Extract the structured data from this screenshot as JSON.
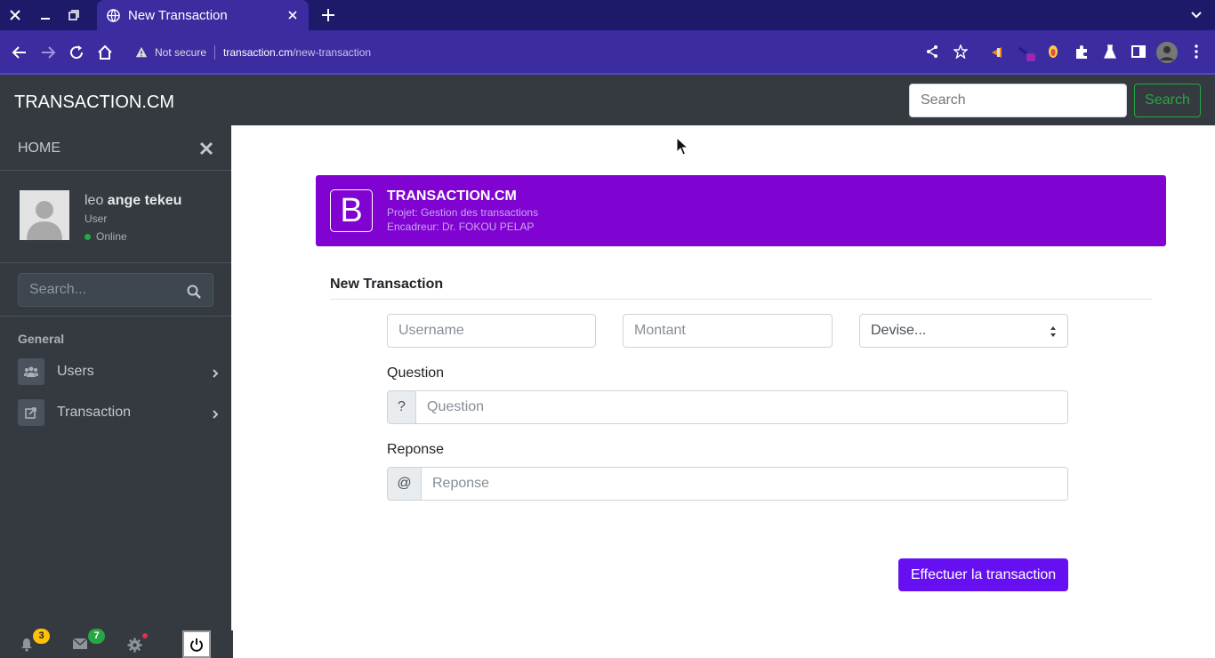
{
  "browser": {
    "tab_title": "New Transaction",
    "url_security": "Not secure",
    "url_host": "transaction.cm",
    "url_path": "/new-transaction"
  },
  "navbar": {
    "brand": "TRANSACTION.CM",
    "search_placeholder": "Search",
    "search_button": "Search"
  },
  "sidebar": {
    "home": "HOME",
    "user": {
      "first": "leo ",
      "rest": "ange tekeu",
      "role": "User",
      "status": "Online"
    },
    "search_placeholder": "Search...",
    "section": "General",
    "items": [
      {
        "label": "Users",
        "icon": "users-icon"
      },
      {
        "label": "Transaction",
        "icon": "share-icon"
      }
    ],
    "footer": {
      "notifications": "3",
      "messages": "7"
    }
  },
  "hero": {
    "logo": "B",
    "title": "TRANSACTION.CM",
    "project": "Projet: Gestion des transactions",
    "supervisor": "Encadreur: Dr. FOKOU PELAP"
  },
  "form": {
    "title": "New Transaction",
    "username_placeholder": "Username",
    "amount_placeholder": "Montant",
    "currency_selected": "Devise...",
    "question_label": "Question",
    "question_addon": "?",
    "question_placeholder": "Question",
    "answer_label": "Reponse",
    "answer_addon": "@",
    "answer_placeholder": "Reponse",
    "submit": "Effectuer la transaction"
  },
  "colors": {
    "hero": "#8003d1",
    "submit": "#6610f2",
    "sidebar": "#343a40",
    "browser": "#3b2ca0"
  }
}
